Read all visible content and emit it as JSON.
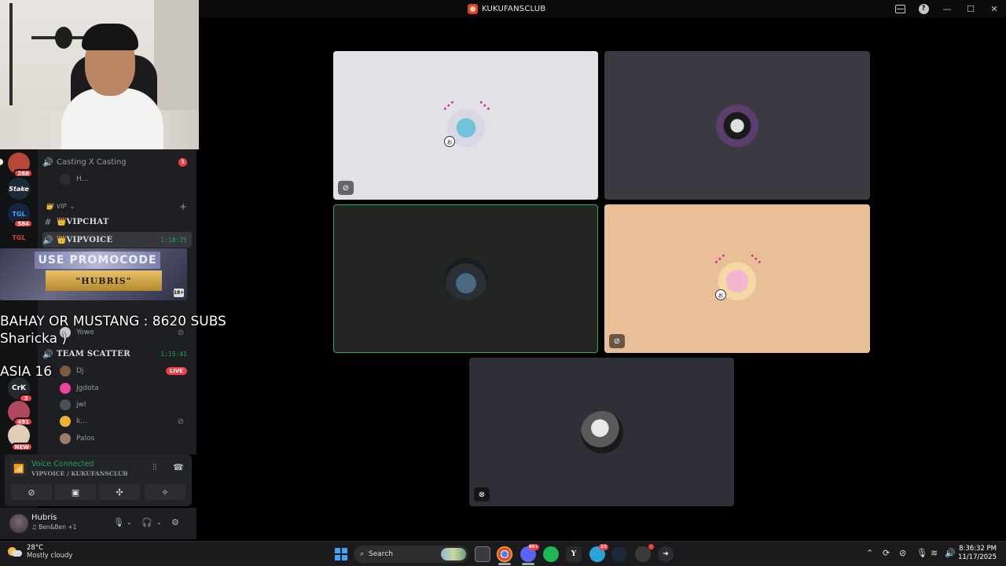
{
  "window": {
    "title": "KUKUFANSCLUB",
    "controls": {
      "minimize": "—",
      "maximize": "☐",
      "close": "✕"
    }
  },
  "colors": {
    "online_green": "#23a55a",
    "badge_red": "#f23f43",
    "speaking_border": "#3ba55d",
    "background": "#000000"
  },
  "servers": [
    {
      "name": "streamer",
      "badge": "268"
    },
    {
      "name": "Stake",
      "label": "Stake",
      "badge": ""
    },
    {
      "name": "tgl-1",
      "label": "TGL",
      "badge": "584"
    },
    {
      "name": "tgl-2",
      "label": "TGL",
      "badge": ""
    },
    {
      "name": "Crk",
      "label": "CrK",
      "badge": "3"
    },
    {
      "name": "anime-server",
      "badge": "491"
    },
    {
      "name": "new-server",
      "badge": "NEW"
    }
  ],
  "channels": {
    "casting": {
      "name": "Casting X Casting",
      "badge": "1",
      "user": "H..."
    },
    "vip_category": "VIP",
    "vipchat": "VIPCHAT",
    "vipvoice": {
      "name": "VIPVOICE",
      "time": "1:18:25"
    },
    "team_scatter": {
      "name": "TEAM SCATTER",
      "time": "1:15:41"
    },
    "users_partial": [
      "Yowe"
    ],
    "users": [
      {
        "name": "Dj",
        "live": "LIVE"
      },
      {
        "name": "Jgdota"
      },
      {
        "name": "jwl"
      },
      {
        "name": "k..."
      },
      {
        "name": "Palos"
      }
    ]
  },
  "promo": {
    "title": "USE PROMOCODE",
    "code": "\"HUBRIS\"",
    "age": "18+"
  },
  "overlay": {
    "line1": "BAHAY OR MUSTANG : 8620 SUBS",
    "line2": "Sharicka )",
    "line3": "ASIA 16"
  },
  "voice": {
    "status": "Voice Connected",
    "channel": "VIPVOICE / KUKUFANSCLUB",
    "buttons": [
      "camera-off",
      "screen-share",
      "activities",
      "soundboard"
    ]
  },
  "user": {
    "name": "Hubris",
    "status": "♫ Ben&Ben +1"
  },
  "call": {
    "tiles": [
      {
        "id": "t1",
        "muted": true
      },
      {
        "id": "t2",
        "muted": false
      },
      {
        "id": "t3",
        "speaking": true
      },
      {
        "id": "t4",
        "muted": true
      },
      {
        "id": "t5",
        "deafened": true
      }
    ]
  },
  "taskbar": {
    "weather_temp": "28°C",
    "weather_desc": "Mostly cloudy",
    "search_placeholder": "Search",
    "apps": [
      {
        "name": "file-explorer"
      },
      {
        "name": "chrome"
      },
      {
        "name": "discord",
        "badge": "99+"
      },
      {
        "name": "spotify"
      },
      {
        "name": "yandex",
        "label": "Y"
      },
      {
        "name": "telegram",
        "badge": "22"
      },
      {
        "name": "steam"
      },
      {
        "name": "app-red"
      },
      {
        "name": "app-arrow"
      }
    ],
    "time": "8:36:32 PM",
    "date": "11/17/2025"
  }
}
